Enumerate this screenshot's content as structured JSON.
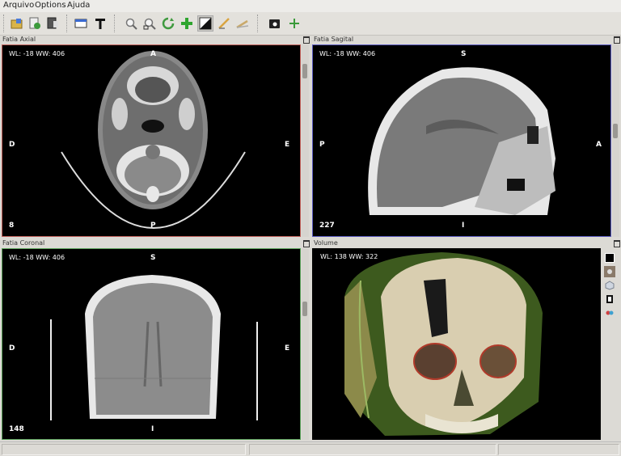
{
  "menu": {
    "file": "Arquivo",
    "options": "Options",
    "help": "Ajuda"
  },
  "toolbar": {
    "tools": [
      "open-folder-icon",
      "import-icon",
      "export-icon",
      "window-layout-icon",
      "text-icon",
      "zoom-in-icon",
      "zoom-region-icon",
      "rotate-icon",
      "crosshair-icon",
      "window-level-icon",
      "measure-icon",
      "angle-icon",
      "screenshot-icon",
      "add-icon"
    ]
  },
  "axial": {
    "title": "Fatia Axial",
    "wlww": "WL: -18  WW: 406",
    "top": "A",
    "bottom": "P",
    "left": "D",
    "right": "E",
    "slice": "8",
    "border": "#c0605a"
  },
  "sagittal": {
    "title": "Fatia Sagital",
    "wlww": "WL: -18  WW: 406",
    "top": "S",
    "bottom": "I",
    "left": "P",
    "right": "A",
    "slice": "227",
    "border": "#5a5ac0"
  },
  "coronal": {
    "title": "Fatia Coronal",
    "wlww": "WL: -18  WW: 406",
    "top": "S",
    "bottom": "I",
    "left": "D",
    "right": "E",
    "slice": "148",
    "border": "#5aa05a"
  },
  "volume": {
    "title": "Volume",
    "wlww": "WL: 138  WW: 322"
  },
  "volume_tools": [
    "background-color-icon",
    "raycasting-icon",
    "cube-icon",
    "reset-view-icon",
    "stereo-icon"
  ]
}
